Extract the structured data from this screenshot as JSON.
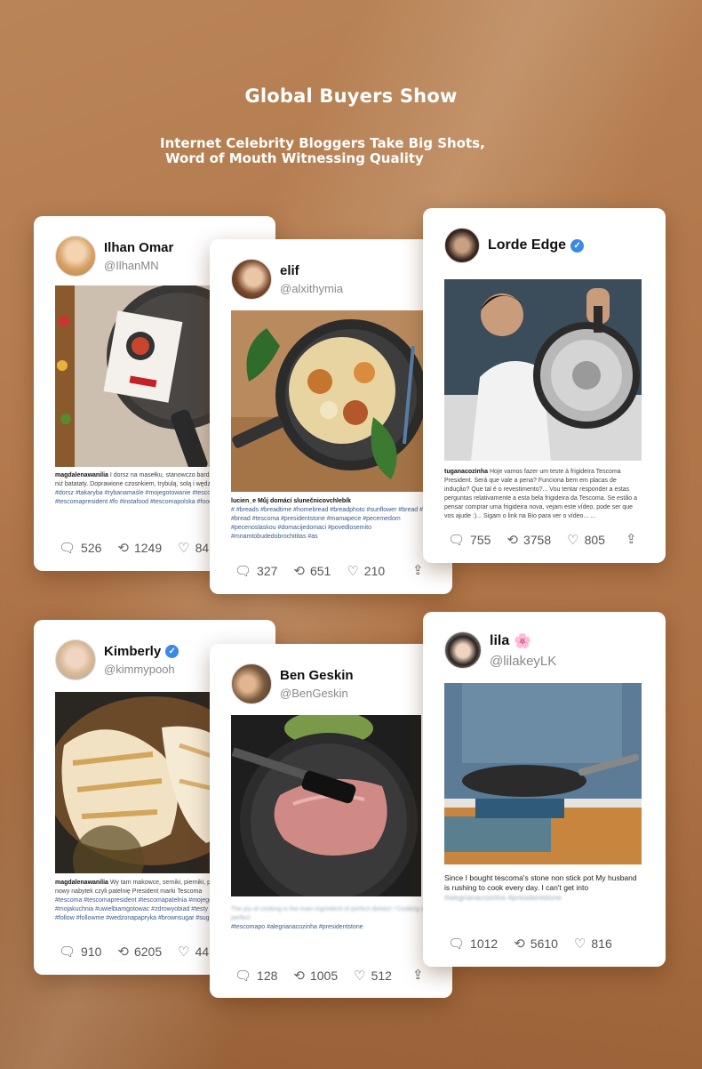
{
  "header": {
    "title": "Global Buyers Show",
    "subtitle_line1": "Internet Celebrity Bloggers Take Big Shots,",
    "subtitle_line2": "Word of Mouth Witnessing Quality"
  },
  "posts": [
    {
      "name": "Ilhan Omar",
      "handle": "@IlhanMN",
      "verified": false,
      "caption_user": "magdalenawanilia",
      "caption": "I dorsz na masełku, stanowczo bardziej mi przypasował niż batataty. Doprawione czosnkiem, trybulą, solą i wędzoną",
      "tags": "#dorsz #takaryba #rybanamaśle #mojegotowanie #tescoma #tescomapatelnia #tescomapresident #fo #instafood #tescomapolska #foodporn",
      "photo_label": "tescoma",
      "comments": "526",
      "retweets": "1249",
      "likes": "84"
    },
    {
      "name": "elif",
      "handle": "@alxithymia",
      "verified": false,
      "caption_user": "lucien_e",
      "caption": "Můj domácí slunečnicovchlebík",
      "tags": "# #breads #breadtime #homebread #breadphoto #sunflower #bread #bread #bread #tescoma #presidentstone #mamapece #pecemedom #pecenoslaskou #domacijedomaci #povedlosemito #mnamtobudedobrochititas #as",
      "comments": "327",
      "retweets": "651",
      "likes": "210"
    },
    {
      "name": "Lorde Edge",
      "handle": "",
      "verified": true,
      "caption_user": "tuganacozinha",
      "caption": "Hoje vamos fazer um teste à frigideira Tescoma President. Será que vale a pena? Funciona bem em placas de indução? Que tal é o revestimento?... Vou tentar responder a estas perguntas relativamente a esta bela frigideira da Tescoma. Se estão a pensar comprar uma frigideira nova, vejam este vídeo, pode ser que vos ajude :)... Sigam o link na Bio para ver o vídeo... ...",
      "tags": "",
      "comments": "755",
      "retweets": "3758",
      "likes": "805"
    },
    {
      "name": "Kimberly",
      "handle": "@kimmypooh",
      "verified": true,
      "caption_user": "magdalenawanilia",
      "caption": "Wy tam makowce, serniki, pierniki, pierogi. A ja testuje mój nowy nabytek czyli patelnię President marki Tescoma",
      "tags": "#tescoma #tescomapresident #tescomapatelnia #mojegotowanie #mojakuchnia #uwielbiamgotowac #zdrowyobiad #testy #instazercie #insta #follow #followme #wedzonapapryka #brownsugar #sugar #glazura",
      "comments": "910",
      "retweets": "6205",
      "likes": "44"
    },
    {
      "name": "Ben Geskin",
      "handle": "@BenGeskin",
      "verified": false,
      "caption_user": "",
      "caption": "The joy of cooking is the main ingredient of perfect dishes! / Cooking joy is perfect",
      "tags": "#tescomapo #alegrianacozinha #presidentstone",
      "comments": "128",
      "retweets": "1005",
      "likes": "512"
    },
    {
      "name": "lila",
      "name_emoji": "🌸",
      "handle": "@lilakeyLK",
      "verified": false,
      "caption_user": "",
      "caption": "Since I bought tescoma's stone non stick pot My husband is rushing to cook every day. I can't get into",
      "tags": "#alegrianacozinha #presidentstone",
      "comments": "1012",
      "retweets": "5610",
      "likes": "816"
    }
  ],
  "icons": {
    "comment": "comment-icon",
    "retweet": "retweet-icon",
    "like": "heart-icon",
    "share": "share-icon"
  }
}
